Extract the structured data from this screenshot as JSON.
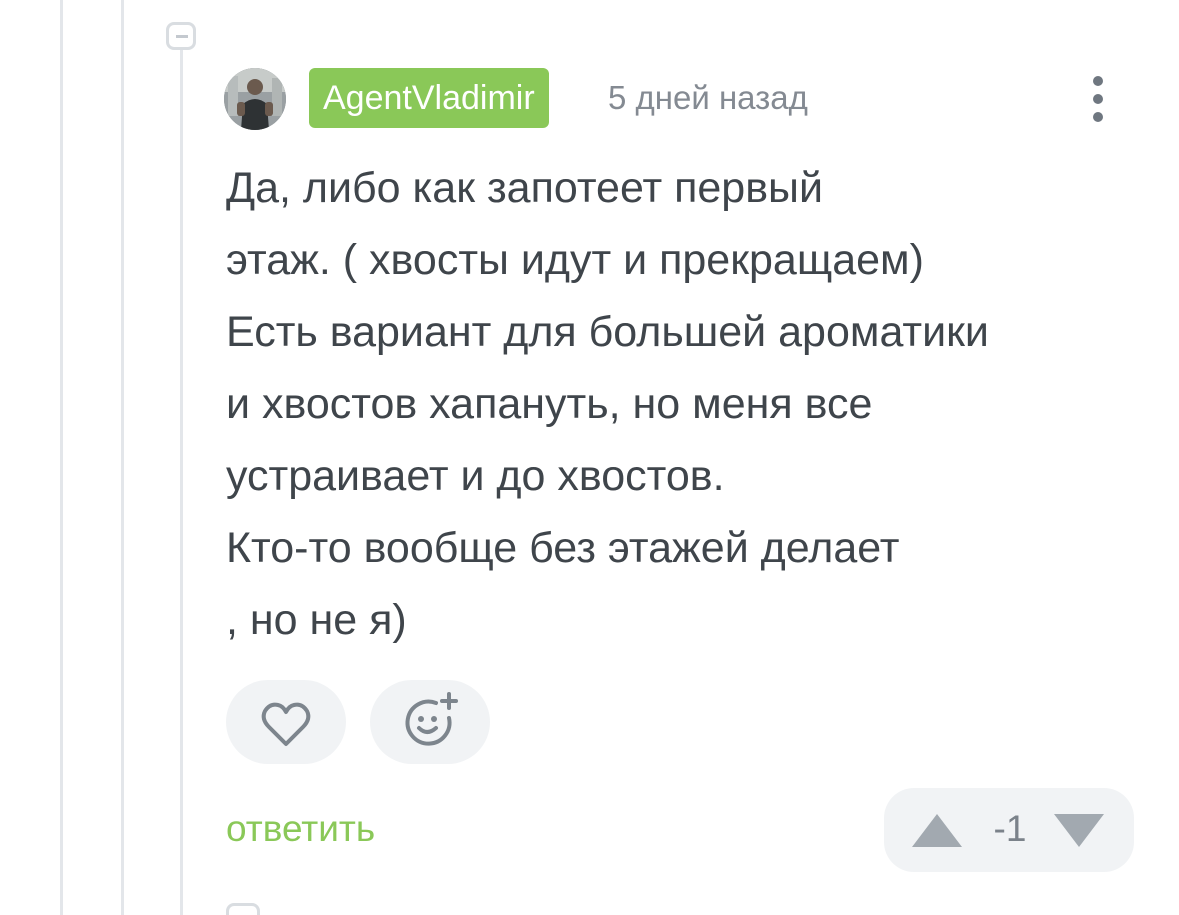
{
  "comment": {
    "author": "AgentVladimir",
    "timestamp": "5 дней назад",
    "body_lines": [
      "Да, либо как запотеет первый",
      "этаж. ( хвосты идут и прекращаем)",
      "Есть вариант для большей ароматики",
      "и хвостов хапануть, но меня все",
      "устраивает и до хвостов.",
      "Кто-то вообще без этажей делает",
      ", но не я)"
    ],
    "reply_label": "ответить",
    "rating": "-1"
  },
  "icons": {
    "collapse": "minus-square-icon",
    "more": "more-vertical-icon",
    "like": "heart-icon",
    "reaction": "add-emoji-icon",
    "upvote": "triangle-up-icon",
    "downvote": "triangle-down-icon"
  },
  "colors": {
    "accent": "#8ac858",
    "thread_line": "#e3e6ea",
    "text": "#3f454b",
    "muted": "#848a92",
    "button_bg": "#f1f3f5"
  }
}
